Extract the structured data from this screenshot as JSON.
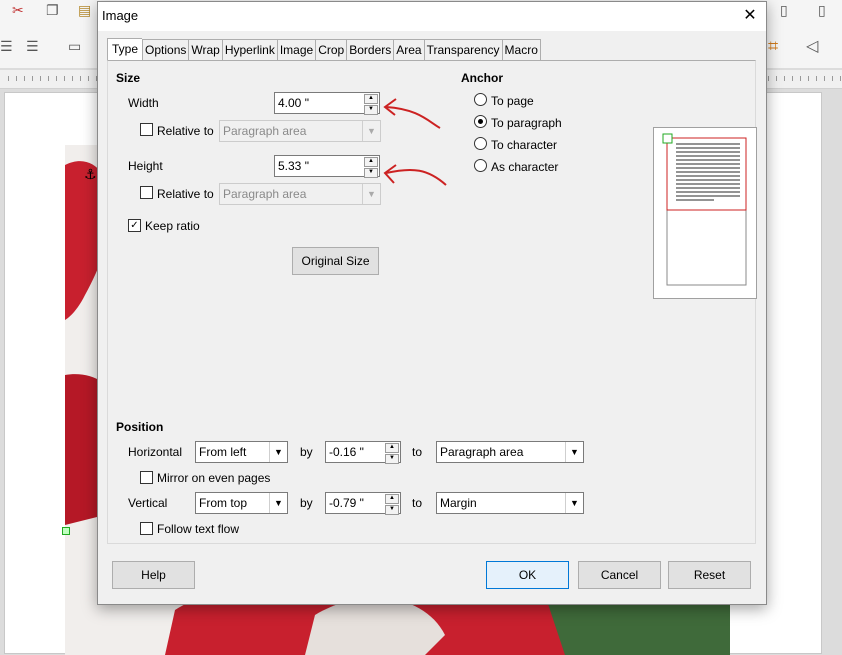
{
  "window": {
    "title": "Image",
    "close_glyph": "✕"
  },
  "tabs": [
    {
      "label": "Type",
      "active": true
    },
    {
      "label": "Options"
    },
    {
      "label": "Wrap"
    },
    {
      "label": "Hyperlink"
    },
    {
      "label": "Image"
    },
    {
      "label": "Crop"
    },
    {
      "label": "Borders"
    },
    {
      "label": "Area"
    },
    {
      "label": "Transparency"
    },
    {
      "label": "Macro"
    }
  ],
  "size": {
    "heading": "Size",
    "width_label": "Width",
    "width_value": "4.00 \"",
    "width_relative_label": "Relative to",
    "width_relative_value": "Paragraph area",
    "height_label": "Height",
    "height_value": "5.33 \"",
    "height_relative_label": "Relative to",
    "height_relative_value": "Paragraph area",
    "keep_ratio_label": "Keep ratio",
    "keep_ratio_checked": true,
    "original_size_label": "Original Size"
  },
  "anchor": {
    "heading": "Anchor",
    "options": [
      {
        "label": "To page",
        "selected": false
      },
      {
        "label": "To paragraph",
        "selected": true
      },
      {
        "label": "To character",
        "selected": false
      },
      {
        "label": "As character",
        "selected": false
      }
    ]
  },
  "position": {
    "heading": "Position",
    "horizontal_label": "Horizontal",
    "horizontal_value": "From left",
    "horizontal_by_label": "by",
    "horizontal_by_value": "-0.16 \"",
    "horizontal_to_label": "to",
    "horizontal_to_value": "Paragraph area",
    "mirror_label": "Mirror on even pages",
    "vertical_label": "Vertical",
    "vertical_value": "From top",
    "vertical_by_label": "by",
    "vertical_by_value": "-0.79 \"",
    "vertical_to_label": "to",
    "vertical_to_value": "Margin",
    "follow_label": "Follow text flow"
  },
  "buttons": {
    "help": "Help",
    "ok": "OK",
    "cancel": "Cancel",
    "reset": "Reset"
  },
  "colors": {
    "annotation_red": "#cc2222",
    "preview_frame": "#cc2222",
    "preview_handle": "#22aa22",
    "rose": "#c8202e",
    "leaf": "#3f6a3a"
  },
  "icons": [
    "scissors-icon",
    "copy-icon",
    "paste-icon",
    "align-left-icon",
    "align-justify-icon",
    "anchor-icon",
    "crop-icon",
    "flip-icon"
  ]
}
